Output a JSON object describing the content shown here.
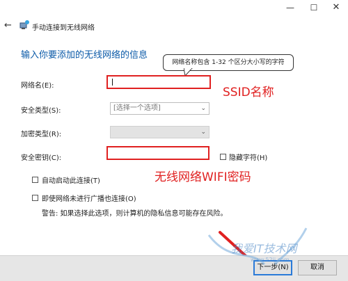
{
  "window": {
    "title": "手动连接到无线网络",
    "controls": {
      "minimize": "—",
      "maximize": "☐",
      "close": "✕"
    }
  },
  "heading": "输入你要添加的无线网络的信息",
  "tooltip": "网络名称包含 1-32 个区分大小写的字符",
  "form": {
    "network_name_label": "网络名(E):",
    "network_name_value": "",
    "security_type_label": "安全类型(S):",
    "security_type_value": "[选择一个选项]",
    "encryption_type_label": "加密类型(R):",
    "encryption_type_value": "",
    "security_key_label": "安全密钥(C):",
    "security_key_value": "",
    "hide_chars_label": "隐藏字符(H)",
    "auto_start_label": "自动启动此连接(T)",
    "connect_not_broadcast_label": "即使网络未进行广播也连接(O)",
    "warning": "警告: 如果选择此选项，则计算机的隐私信息可能存在风险。"
  },
  "annotations": {
    "ssid": "SSID名称",
    "wifi_password": "无线网络WIFI密码"
  },
  "buttons": {
    "next": "下一步(N)",
    "cancel": "取消"
  },
  "watermark": {
    "text": "我爱IT技术网",
    "url": "www.52ij.com"
  },
  "colors": {
    "heading": "#0b5aa8",
    "annotation_red": "#e02020",
    "default_button_border": "#2a7ad8"
  }
}
